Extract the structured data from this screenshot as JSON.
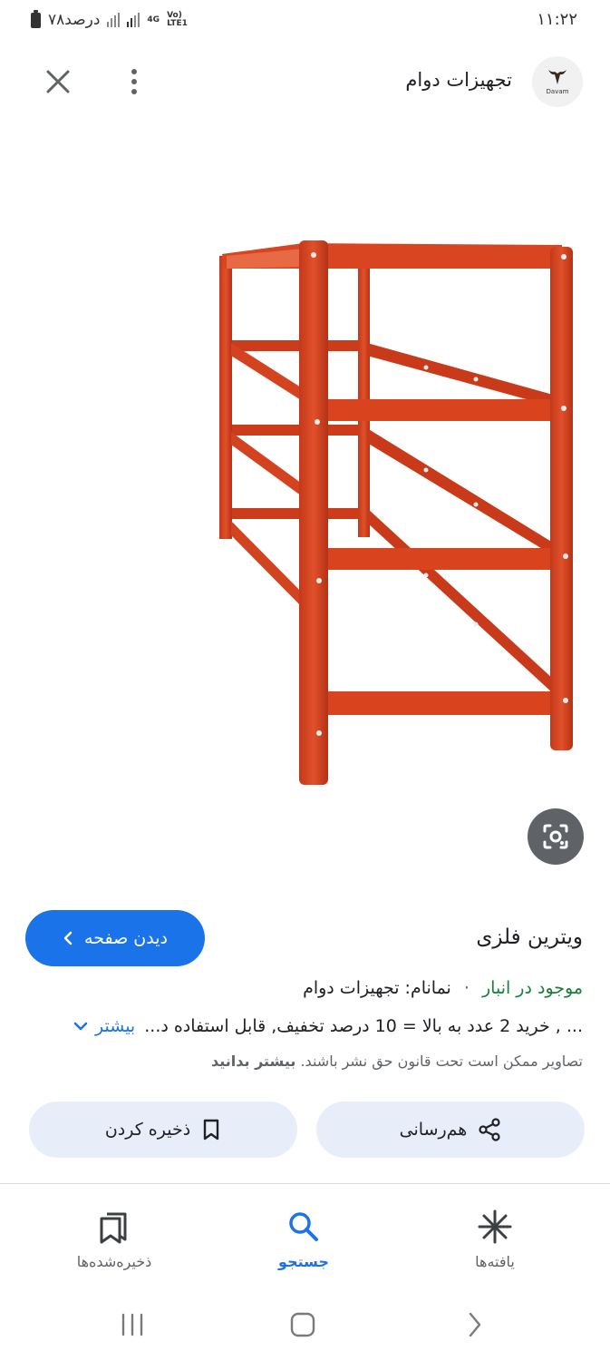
{
  "status_bar": {
    "time": "۱۱:۲۲",
    "battery_text": "۷۸درصد",
    "network_top": "4G",
    "network_bottom": "Vo) LTE1"
  },
  "header": {
    "site_name": "تجهیزات دوام",
    "logo_text": "Davam"
  },
  "result": {
    "visit_label": "دیدن صفحه",
    "title": "ویترین فلزی",
    "stock": "موجود در انبار",
    "separator": "·",
    "brand": "نمانام: تجهیزات دوام",
    "description": "... , خرید 2 عدد به بالا = 10 درصد تخفیف, قابل استفاده د...",
    "more_label": "بیشتر",
    "copyright_text": "تصاویر ممکن است تحت قانون حق نشر باشند.",
    "learn_more": "بیشتر بدانید"
  },
  "actions": {
    "share_label": "هم‌رسانی",
    "save_label": "ذخیره کردن"
  },
  "bottom_nav": {
    "items": [
      {
        "label": "یافته‌ها",
        "icon": "asterisk-icon",
        "active": false
      },
      {
        "label": "جستجو",
        "icon": "search-icon",
        "active": true
      },
      {
        "label": "ذخیره‌شده‌ها",
        "icon": "collections-icon",
        "active": false
      }
    ]
  },
  "colors": {
    "accent": "#1a73e8",
    "stock_green": "#188038",
    "shelf_orange": "#d9411e",
    "chip_bg": "#e8eef9"
  }
}
